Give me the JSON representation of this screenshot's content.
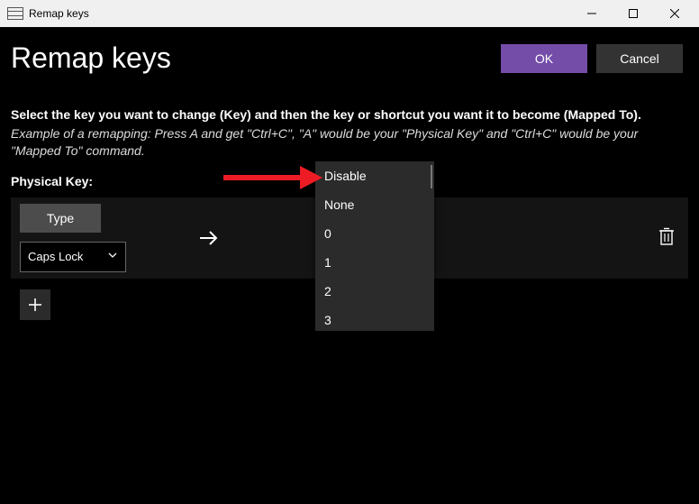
{
  "window": {
    "title": "Remap keys"
  },
  "header": {
    "title": "Remap keys",
    "ok": "OK",
    "cancel": "Cancel"
  },
  "body": {
    "instruction": "Select the key you want to change (Key) and then the key or shortcut you want it to become (Mapped To).",
    "example": "Example of a remapping: Press A and get \"Ctrl+C\", \"A\" would be your \"Physical Key\" and \"Ctrl+C\" would be your \"Mapped To\" command.",
    "physical_key_label": "Physical Key:",
    "type_button": "Type",
    "selected_key": "Caps Lock"
  },
  "dropdown": {
    "options": [
      "Disable",
      "None",
      "0",
      "1",
      "2",
      "3"
    ]
  },
  "colors": {
    "accent": "#744DA9",
    "annotation": "#ED1C24"
  }
}
